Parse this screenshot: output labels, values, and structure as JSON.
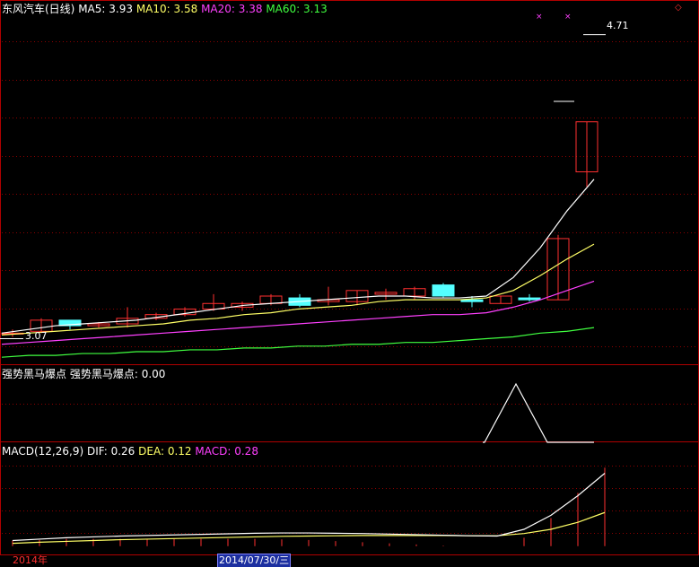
{
  "main_panel": {
    "stock_name": "东风汽车(日线)",
    "ma5_label": "MA5:",
    "ma5_value": "3.93",
    "ma10_label": "MA10:",
    "ma10_value": "3.58",
    "ma20_label": "MA20:",
    "ma20_value": "3.38",
    "ma60_label": "MA60:",
    "ma60_value": "3.13",
    "high_marker": "4.71",
    "low_marker": "3.07"
  },
  "indicator_panel": {
    "name": "强势黑马爆点",
    "value_label": "强势黑马爆点:",
    "value": "0.00"
  },
  "macd_panel": {
    "name": "MACD(12,26,9)",
    "dif_label": "DIF:",
    "dif_value": "0.26",
    "dea_label": "DEA:",
    "dea_value": "0.12",
    "macd_label": "MACD:",
    "macd_value": "0.28"
  },
  "time_axis": {
    "year_label": "2014年",
    "cursor_date": "2014/07/30/三"
  },
  "colors": {
    "up": "#ff3030",
    "down": "#54ffff",
    "ma5": "#ffffff",
    "ma10": "#ffff66",
    "ma20": "#ff40ff",
    "ma60": "#40ff40",
    "grid": "#8b0000",
    "border": "#b00000"
  },
  "chart_data": [
    {
      "type": "candlestick",
      "title": "东风汽车(日线)",
      "ylim": [
        3.0,
        4.8
      ],
      "candles": [
        {
          "o": 3.1,
          "h": 3.12,
          "c": 3.1,
          "l": 3.08
        },
        {
          "o": 3.11,
          "h": 3.18,
          "c": 3.17,
          "l": 3.1
        },
        {
          "o": 3.17,
          "h": 3.17,
          "c": 3.14,
          "l": 3.12
        },
        {
          "o": 3.14,
          "h": 3.16,
          "c": 3.15,
          "l": 3.13
        },
        {
          "o": 3.15,
          "h": 3.24,
          "c": 3.18,
          "l": 3.13
        },
        {
          "o": 3.18,
          "h": 3.21,
          "c": 3.2,
          "l": 3.17
        },
        {
          "o": 3.2,
          "h": 3.24,
          "c": 3.23,
          "l": 3.19
        },
        {
          "o": 3.23,
          "h": 3.31,
          "c": 3.26,
          "l": 3.22
        },
        {
          "o": 3.24,
          "h": 3.27,
          "c": 3.26,
          "l": 3.22
        },
        {
          "o": 3.26,
          "h": 3.31,
          "c": 3.3,
          "l": 3.25
        },
        {
          "o": 3.29,
          "h": 3.31,
          "c": 3.25,
          "l": 3.24
        },
        {
          "o": 3.27,
          "h": 3.35,
          "c": 3.28,
          "l": 3.25
        },
        {
          "o": 3.27,
          "h": 3.33,
          "c": 3.33,
          "l": 3.25
        },
        {
          "o": 3.31,
          "h": 3.34,
          "c": 3.32,
          "l": 3.28
        },
        {
          "o": 3.3,
          "h": 3.35,
          "c": 3.34,
          "l": 3.28
        },
        {
          "o": 3.36,
          "h": 3.37,
          "c": 3.3,
          "l": 3.29
        },
        {
          "o": 3.28,
          "h": 3.3,
          "c": 3.27,
          "l": 3.24
        },
        {
          "o": 3.26,
          "h": 3.3,
          "c": 3.3,
          "l": 3.26
        },
        {
          "o": 3.29,
          "h": 3.31,
          "c": 3.28,
          "l": 3.27
        },
        {
          "o": 3.28,
          "h": 3.63,
          "c": 3.61,
          "l": 3.28
        },
        {
          "o": 3.97,
          "h": 4.24,
          "c": 4.24,
          "l": 3.89
        }
      ],
      "ma5": [
        3.1,
        3.12,
        3.14,
        3.15,
        3.16,
        3.17,
        3.19,
        3.21,
        3.23,
        3.25,
        3.26,
        3.27,
        3.28,
        3.29,
        3.3,
        3.3,
        3.29,
        3.29,
        3.3,
        3.4,
        3.56,
        3.76,
        3.93
      ],
      "ma10": [
        3.09,
        3.1,
        3.11,
        3.12,
        3.13,
        3.14,
        3.15,
        3.17,
        3.18,
        3.2,
        3.21,
        3.23,
        3.24,
        3.25,
        3.27,
        3.28,
        3.28,
        3.28,
        3.29,
        3.33,
        3.41,
        3.5,
        3.58
      ],
      "ma20": [
        3.04,
        3.05,
        3.06,
        3.07,
        3.08,
        3.09,
        3.1,
        3.11,
        3.12,
        3.13,
        3.14,
        3.15,
        3.16,
        3.17,
        3.18,
        3.19,
        3.2,
        3.2,
        3.21,
        3.24,
        3.28,
        3.33,
        3.38
      ],
      "ma60": [
        2.97,
        2.98,
        2.98,
        2.99,
        2.99,
        3.0,
        3.0,
        3.01,
        3.01,
        3.02,
        3.02,
        3.03,
        3.03,
        3.04,
        3.04,
        3.05,
        3.05,
        3.06,
        3.07,
        3.08,
        3.1,
        3.11,
        3.13
      ],
      "annotations": {
        "high": 4.71,
        "low": 3.07
      }
    },
    {
      "type": "line",
      "title": "强势黑马爆点",
      "ylim": [
        0,
        1
      ],
      "values": [
        0,
        0,
        0,
        0,
        0,
        0,
        0,
        0,
        0,
        0,
        0,
        0,
        0,
        0,
        0,
        0,
        0,
        0,
        0,
        1,
        0,
        0,
        0
      ]
    },
    {
      "type": "line",
      "title": "MACD(12,26,9)",
      "ylim": [
        -0.02,
        0.3
      ],
      "dif": [
        0.02,
        0.025,
        0.03,
        0.033,
        0.036,
        0.038,
        0.04,
        0.042,
        0.044,
        0.046,
        0.047,
        0.047,
        0.046,
        0.045,
        0.043,
        0.041,
        0.039,
        0.037,
        0.036,
        0.06,
        0.11,
        0.18,
        0.26
      ],
      "dea": [
        0.01,
        0.014,
        0.017,
        0.02,
        0.023,
        0.025,
        0.027,
        0.029,
        0.031,
        0.033,
        0.035,
        0.036,
        0.037,
        0.038,
        0.038,
        0.038,
        0.038,
        0.037,
        0.037,
        0.045,
        0.06,
        0.085,
        0.12
      ],
      "macd": [
        0.02,
        0.022,
        0.026,
        0.026,
        0.026,
        0.026,
        0.026,
        0.026,
        0.026,
        0.026,
        0.024,
        0.022,
        0.018,
        0.014,
        0.01,
        0.006,
        0.002,
        0.0,
        0.0,
        0.03,
        0.1,
        0.19,
        0.28
      ]
    }
  ]
}
